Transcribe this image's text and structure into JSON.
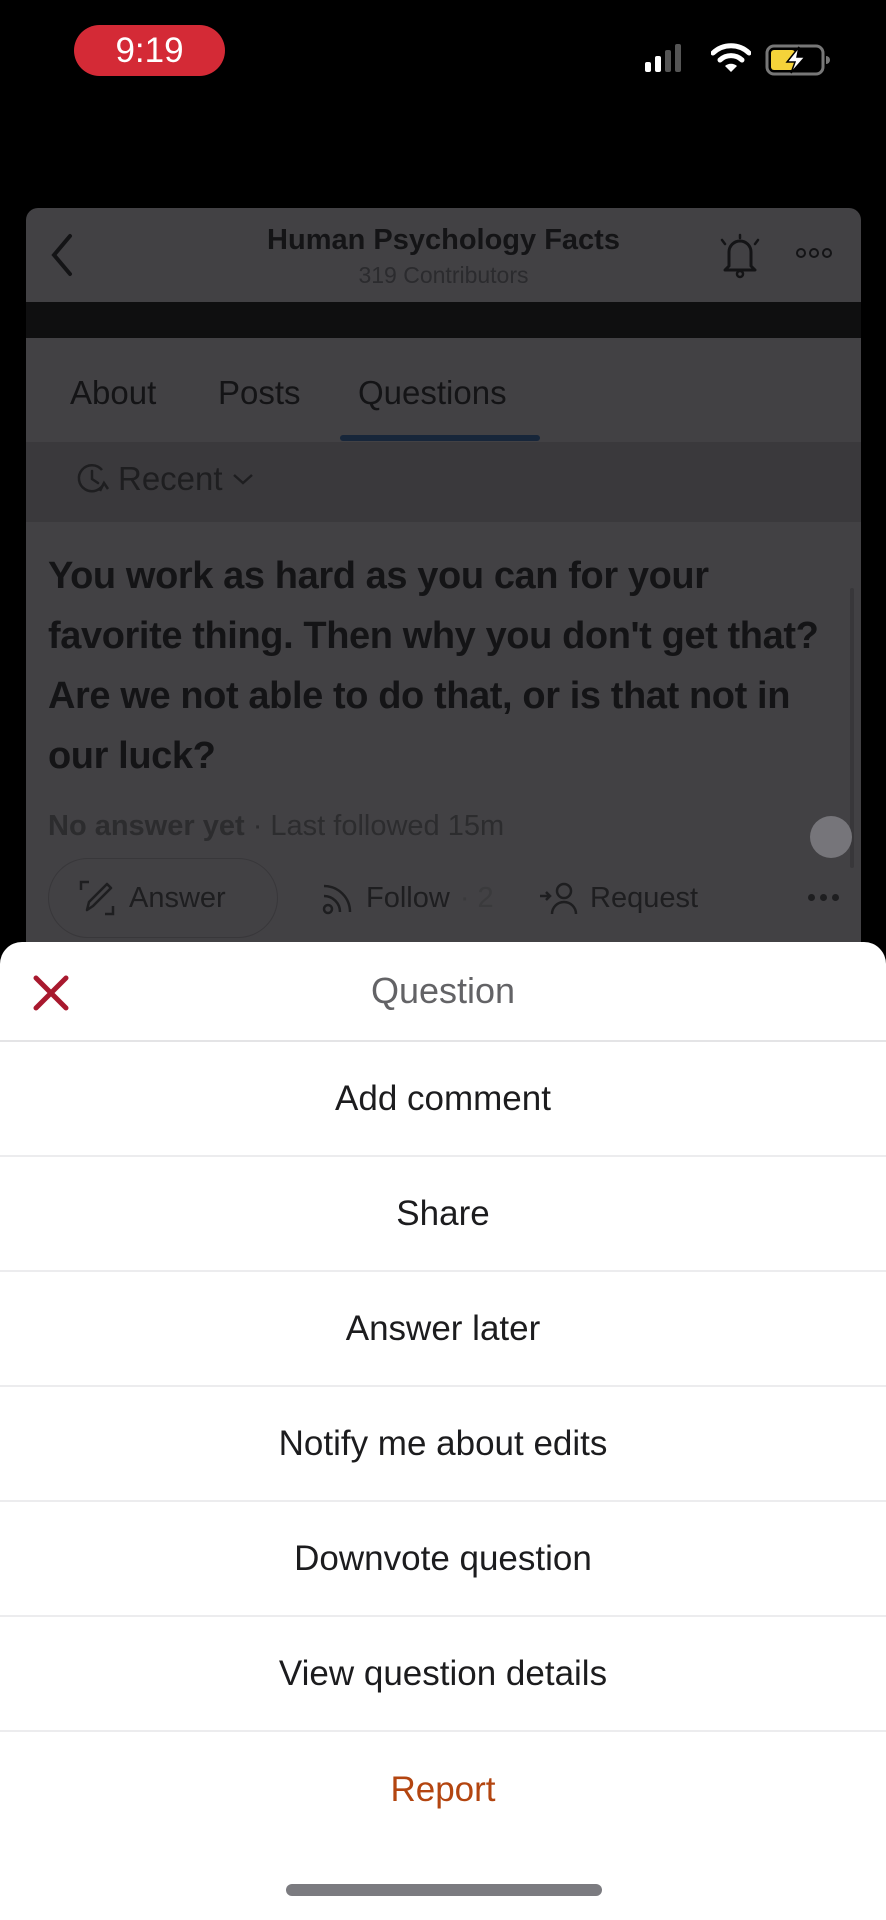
{
  "status_bar": {
    "time": "9:19",
    "signal_bars": 2,
    "signal_total": 4,
    "battery_charging": true,
    "battery_color": "#f5d33a",
    "time_pill_color": "#d42a36"
  },
  "space": {
    "title": "Human Psychology Facts",
    "subtitle": "319 Contributors",
    "tabs": [
      {
        "label": "About",
        "active": false
      },
      {
        "label": "Posts",
        "active": false
      },
      {
        "label": "Questions",
        "active": true
      }
    ],
    "filter": {
      "label": "Recent"
    }
  },
  "question": {
    "text": "You work as hard as you can for your favorite thing. Then why you don't get that? Are we not able to do that, or is that not in our luck?",
    "status": "No answer yet",
    "meta": " · Last followed 15m",
    "actions": {
      "answer": "Answer",
      "follow": "Follow",
      "follow_count": "· 2",
      "request": "Request"
    }
  },
  "sheet": {
    "title": "Question",
    "close_color": "#a8192e",
    "items": [
      {
        "label": "Add comment"
      },
      {
        "label": "Share"
      },
      {
        "label": "Answer later"
      },
      {
        "label": "Notify me about edits"
      },
      {
        "label": "Downvote question"
      },
      {
        "label": "View question details"
      },
      {
        "label": "Report",
        "danger": true,
        "color": "#b34510"
      }
    ]
  }
}
